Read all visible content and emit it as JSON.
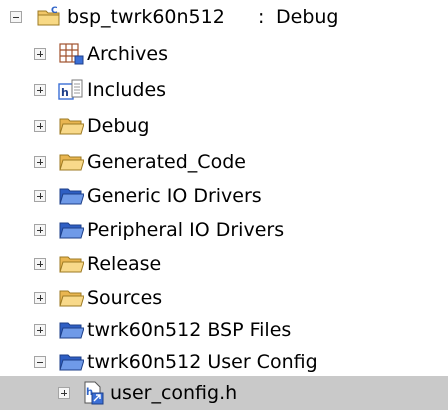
{
  "project": {
    "name": "bsp_twrk60n512",
    "separator": ":",
    "config": "Debug"
  },
  "items": [
    {
      "label": "Archives",
      "icon": "archives-grid-icon",
      "state": "collapsed"
    },
    {
      "label": "Includes",
      "icon": "includes-icon",
      "state": "collapsed"
    },
    {
      "label": "Debug",
      "icon": "folder-icon",
      "state": "collapsed"
    },
    {
      "label": "Generated_Code",
      "icon": "folder-icon",
      "state": "collapsed"
    },
    {
      "label": "Generic IO Drivers",
      "icon": "linked-folder-icon",
      "state": "collapsed"
    },
    {
      "label": "Peripheral IO Drivers",
      "icon": "linked-folder-icon",
      "state": "collapsed"
    },
    {
      "label": "Release",
      "icon": "folder-icon",
      "state": "collapsed"
    },
    {
      "label": "Sources",
      "icon": "folder-icon",
      "state": "collapsed"
    },
    {
      "label": "twrk60n512 BSP Files",
      "icon": "linked-folder-icon",
      "state": "collapsed"
    },
    {
      "label": "twrk60n512 User Config",
      "icon": "linked-folder-icon",
      "state": "expanded"
    }
  ],
  "child": {
    "label": "user_config.h",
    "icon": "header-file-link-icon",
    "state": "collapsed",
    "selected": true
  },
  "colors": {
    "folder_yellow": "#f5c96a",
    "folder_blue": "#3b6fd6",
    "selection": "#c9c9c9"
  }
}
